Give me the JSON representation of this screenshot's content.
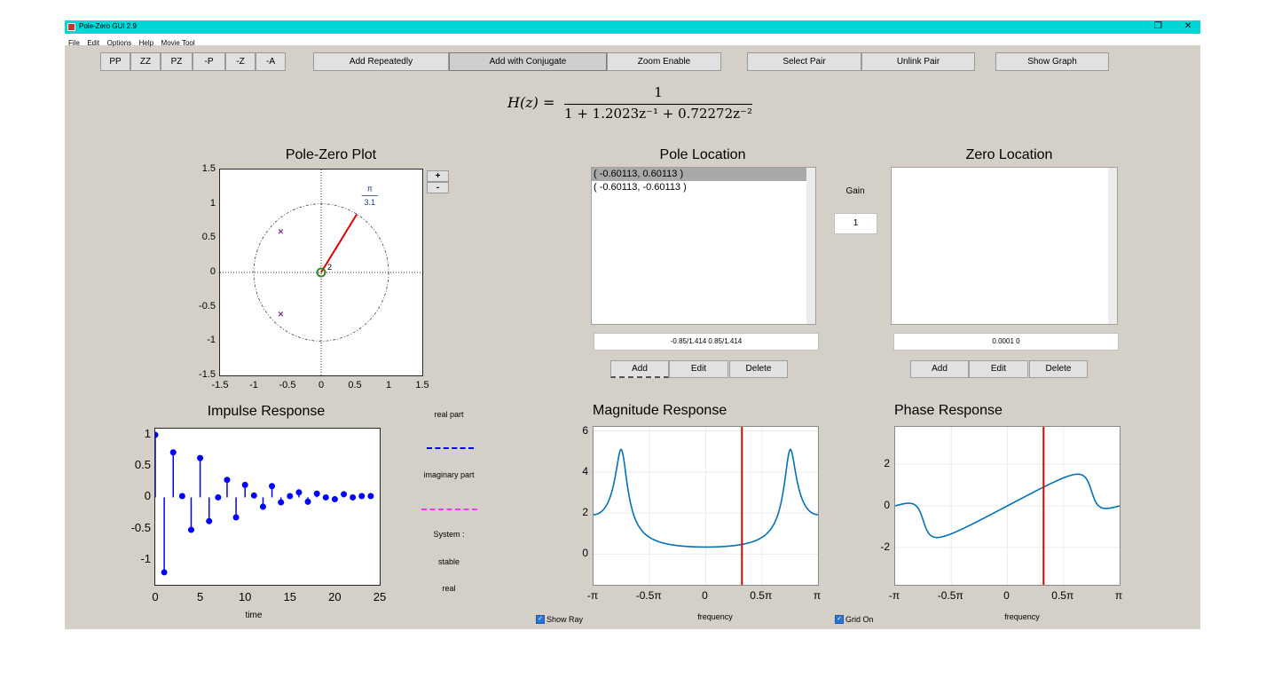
{
  "window": {
    "title": "Pole-Zero GUI 2.9",
    "restore_icon": "restore-icon",
    "close_icon": "close-icon"
  },
  "menu": [
    "File",
    "Edit",
    "Options",
    "Help",
    "Movie Tool"
  ],
  "toolbar": {
    "small_buttons": [
      "PP",
      "ZZ",
      "PZ",
      "-P",
      "-Z",
      "-A"
    ],
    "add_repeatedly": "Add Repeatedly",
    "add_with_conjugate": "Add with Conjugate",
    "zoom_enable": "Zoom Enable",
    "select_pair": "Select Pair",
    "unlink_pair": "Unlink Pair",
    "show_graph": "Show Graph"
  },
  "transfer_function": {
    "lhs": "H(z) =",
    "numerator": "1",
    "denominator": "1 + 1.2023z⁻¹ + 0.72272z⁻²"
  },
  "pole_zero_plot": {
    "title": "Pole-Zero Plot",
    "zoom_in": "+",
    "zoom_out": "-",
    "ticks": [
      "-1.5",
      "-1",
      "-0.5",
      "0",
      "0.5",
      "1",
      "1.5"
    ],
    "y_ticks": [
      "1.5",
      "1",
      "0.5",
      "0",
      "-0.5",
      "-1",
      "-1.5"
    ],
    "poles": [
      {
        "re": -0.60113,
        "im": 0.60113
      },
      {
        "re": -0.60113,
        "im": -0.60113
      }
    ],
    "zero_multiplicity": "2",
    "ray_label_num": "π",
    "ray_label_den": "3.1",
    "ray_angle_fraction_of_pi": 0.3226
  },
  "pole_location": {
    "title": "Pole Location",
    "items": [
      "( -0.60113, 0.60113 )",
      "( -0.60113, -0.60113 )"
    ],
    "input_value": "-0.85/1.414 0.85/1.414",
    "add": "Add",
    "edit": "Edit",
    "delete": "Delete"
  },
  "gain": {
    "label": "Gain",
    "value": "1"
  },
  "zero_location": {
    "title": "Zero Location",
    "input_value": "0.0001  0",
    "add": "Add",
    "edit": "Edit",
    "delete": "Delete"
  },
  "impulse": {
    "title": "Impulse Response",
    "xlabel": "time",
    "x_ticks": [
      "0",
      "5",
      "10",
      "15",
      "20",
      "25"
    ],
    "y_ticks": [
      "1",
      "0.5",
      "0",
      "-0.5",
      "-1"
    ]
  },
  "legend_panel": {
    "real_part": "real part",
    "imaginary_part": "imaginary part",
    "system": "System :",
    "stable": "stable",
    "real": "real"
  },
  "magnitude": {
    "title": "Magnitude Response",
    "xlabel": "frequency",
    "x_ticks": [
      "-π",
      "-0.5π",
      "0",
      "0.5π",
      "π"
    ],
    "y_ticks": [
      "6",
      "4",
      "2",
      "0"
    ]
  },
  "phase": {
    "title": "Phase Response",
    "xlabel": "frequency",
    "x_ticks": [
      "-π",
      "-0.5π",
      "0",
      "0.5π",
      "π"
    ],
    "y_ticks": [
      "2",
      "0",
      "-2"
    ]
  },
  "checkboxes": {
    "show_ray": "Show Ray",
    "grid_on": "Grid On"
  },
  "colors": {
    "accent": "#00d6d6",
    "stem": "#0000ff",
    "curve": "#0072bd",
    "marker_line": "#e00000",
    "pole": "#7e2f8e",
    "zero": "#2e8b22",
    "imag_line": "#ff33ff"
  },
  "chart_data": [
    {
      "type": "scatter",
      "title": "Pole-Zero Plot",
      "poles": [
        [
          -0.60113,
          0.60113
        ],
        [
          -0.60113,
          -0.60113
        ]
      ],
      "zeros": [
        [
          0,
          0
        ],
        [
          0,
          0
        ]
      ],
      "xlim": [
        -1.5,
        1.5
      ],
      "ylim": [
        -1.5,
        1.5
      ]
    },
    {
      "type": "stem",
      "title": "Impulse Response",
      "xlabel": "time",
      "x": [
        0,
        1,
        2,
        3,
        4,
        5,
        6,
        7,
        8,
        9,
        10,
        11,
        12,
        13,
        14,
        15,
        16,
        17,
        18,
        19,
        20,
        21,
        22,
        23,
        24
      ],
      "values": [
        1,
        -1.2,
        0.72,
        0.02,
        -0.52,
        0.63,
        -0.38,
        0.0,
        0.28,
        -0.32,
        0.2,
        0.03,
        -0.15,
        0.18,
        -0.08,
        0.02,
        0.08,
        -0.07,
        0.06,
        0.0,
        -0.03,
        0.05,
        0.0,
        0.02,
        0.02
      ],
      "xlim": [
        0,
        25
      ],
      "ylim": [
        -1.4,
        1.1
      ]
    },
    {
      "type": "line",
      "title": "Magnitude Response",
      "xlabel": "frequency",
      "xlim": [
        -3.14159,
        3.14159
      ],
      "ylim": [
        -1.5,
        6.2
      ],
      "marker_x": 1.0134
    },
    {
      "type": "line",
      "title": "Phase Response",
      "xlabel": "frequency",
      "xlim": [
        -3.14159,
        3.14159
      ],
      "ylim": [
        -3.8,
        3.8
      ],
      "marker_x": 1.0134
    }
  ]
}
